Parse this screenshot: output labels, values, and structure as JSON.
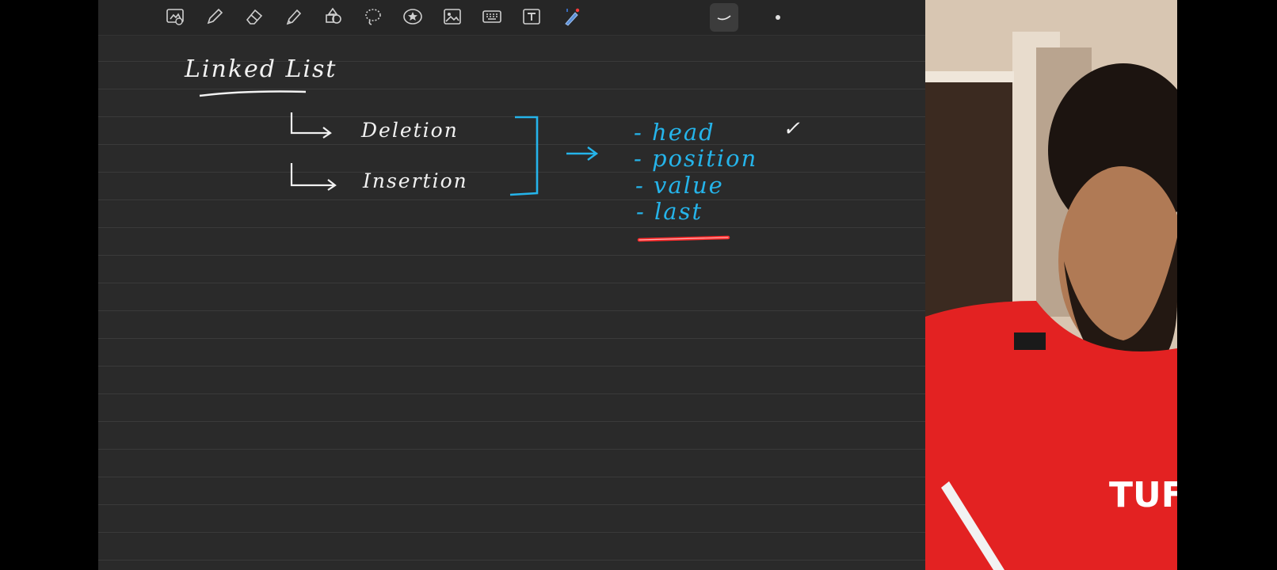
{
  "toolbar": {
    "tools": [
      {
        "name": "add-page-icon"
      },
      {
        "name": "pen-icon"
      },
      {
        "name": "eraser-icon"
      },
      {
        "name": "highlighter-icon"
      },
      {
        "name": "shapes-icon"
      },
      {
        "name": "lasso-icon"
      },
      {
        "name": "sticker-icon"
      },
      {
        "name": "image-icon"
      },
      {
        "name": "keyboard-icon"
      },
      {
        "name": "text-icon"
      },
      {
        "name": "laser-pointer-icon"
      },
      {
        "name": "pen-size-dot-icon"
      },
      {
        "name": "stroke-style-icon"
      }
    ]
  },
  "note": {
    "title": "Linked List",
    "branch1": "Deletion",
    "branch2": "Insertion",
    "items": [
      "- head",
      "- position",
      "- value",
      "- last"
    ],
    "check": "✓"
  },
  "colors": {
    "background": "#2a2a2a",
    "ink_white": "#f2f2f2",
    "ink_blue": "#25b4ea",
    "ink_red": "#ff2a2a",
    "shirt_red": "#e32222"
  }
}
